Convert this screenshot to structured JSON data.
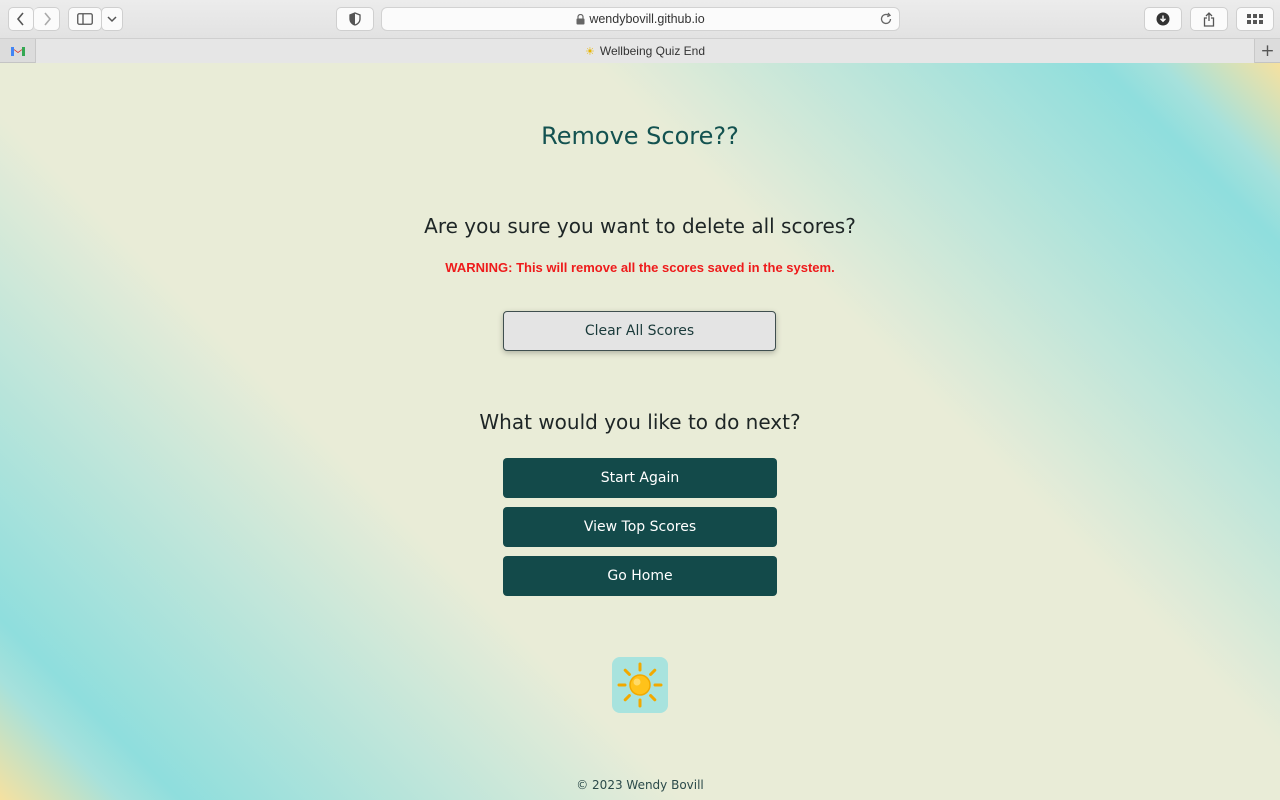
{
  "browser": {
    "url": "wendybovill.github.io",
    "tab_title": "Wellbeing Quiz End",
    "new_tab_label": "+"
  },
  "page": {
    "title": "Remove Score??",
    "question": "Are you sure you want to delete all scores?",
    "warning": "WARNING: This will remove all the scores saved in the system.",
    "clear_button": "Clear All Scores",
    "next_question": "What would you like to do next?",
    "actions": [
      {
        "label": "Start Again"
      },
      {
        "label": "View Top Scores"
      },
      {
        "label": "Go Home"
      }
    ],
    "logo_icon": "sun-icon",
    "footer": "© 2023 Wendy Bovill"
  },
  "colors": {
    "title": "#135250",
    "warning": "#ee1b1b",
    "dark_button": "#134a4a",
    "logo_bg": "#a8e3de"
  }
}
